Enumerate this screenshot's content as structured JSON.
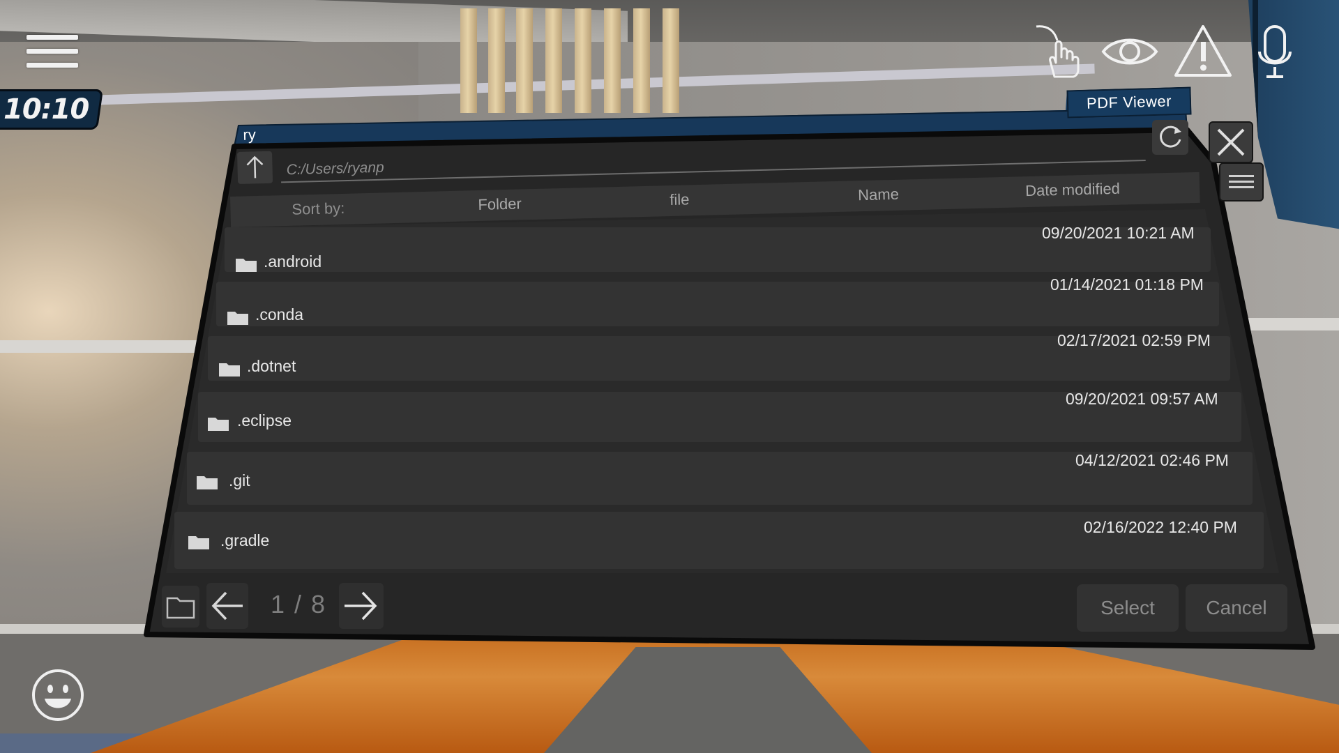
{
  "hud": {
    "clock": "10:10",
    "icons": [
      "hamburger-menu-icon",
      "hand-pointer-icon",
      "eye-icon",
      "warning-icon",
      "microphone-icon",
      "smiley-face-icon"
    ]
  },
  "dialog": {
    "window_title": "PDF Viewer",
    "path_title": "ry",
    "path_value": "C:/Users/ryanp",
    "sort": {
      "label": "Sort by:",
      "options": [
        "Folder",
        "file",
        "Name",
        "Date modified"
      ]
    },
    "entries": [
      {
        "name": ".android",
        "date": "09/20/2021 10:21 AM",
        "icon": "folder-icon"
      },
      {
        "name": ".conda",
        "date": "01/14/2021 01:18 PM",
        "icon": "folder-icon"
      },
      {
        "name": ".dotnet",
        "date": "02/17/2021 02:59 PM",
        "icon": "folder-icon"
      },
      {
        "name": ".eclipse",
        "date": "09/20/2021 09:57 AM",
        "icon": "folder-icon"
      },
      {
        "name": ".git",
        "date": "04/12/2021 02:46 PM",
        "icon": "folder-icon"
      },
      {
        "name": ".gradle",
        "date": "02/16/2022 12:40 PM",
        "icon": "folder-icon"
      }
    ],
    "pagination": "1 / 8",
    "select_label": "Select",
    "cancel_label": "Cancel"
  },
  "colors": {
    "panel_bg": "#262626",
    "row_bg": "#333333",
    "title_bar": "#163b5f",
    "text": "#e8e8e8",
    "muted_text": "#8d8d8d"
  }
}
